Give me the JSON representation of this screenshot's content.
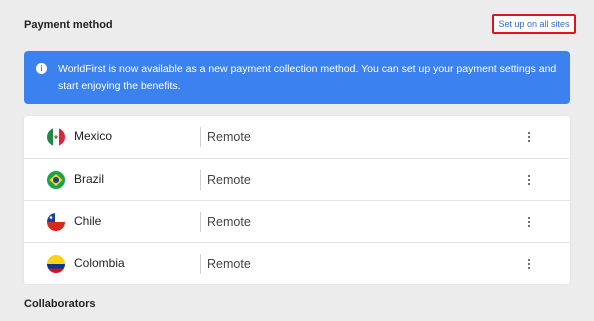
{
  "payment_section": {
    "title": "Payment method",
    "setup_button_label": "Set up on all sites"
  },
  "banner": {
    "icon": "info-icon",
    "text": "WorldFirst is now available as a new payment collection method. You can set up your payment settings and start enjoying the benefits."
  },
  "countries": [
    {
      "name": "Mexico",
      "status": "Remote",
      "flag": "mexico-flag-icon"
    },
    {
      "name": "Brazil",
      "status": "Remote",
      "flag": "brazil-flag-icon"
    },
    {
      "name": "Chile",
      "status": "Remote",
      "flag": "chile-flag-icon"
    },
    {
      "name": "Colombia",
      "status": "Remote",
      "flag": "colombia-flag-icon"
    }
  ],
  "collaborators_section": {
    "title": "Collaborators"
  },
  "colors": {
    "banner_bg": "#3b82f0",
    "link": "#2c6fd6",
    "highlight_border": "#e0141e"
  }
}
